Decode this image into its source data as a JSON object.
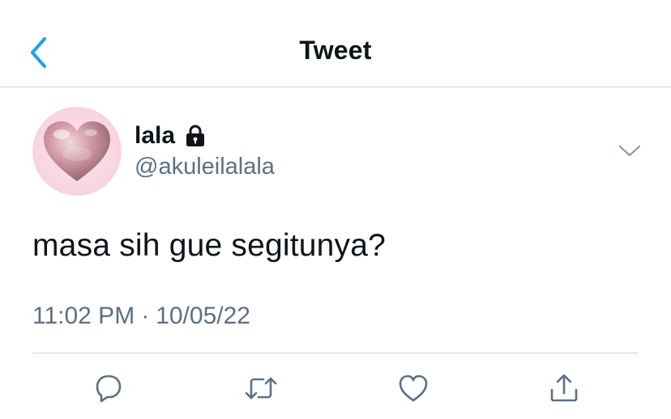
{
  "header": {
    "title": "Tweet",
    "back_icon": "chevron-left-icon"
  },
  "tweet": {
    "author_name": "lala",
    "author_handle": "@akuleilalala",
    "protected_icon": "lock-icon",
    "text": "masa sih gue segitunya?",
    "time": "11:02 PM",
    "separator": "·",
    "date": "10/05/22"
  },
  "actions": [
    "reply-icon",
    "retweet-icon",
    "like-icon",
    "share-icon"
  ],
  "colors": {
    "accent": "#1da1f2",
    "secondary_text": "#5b7083",
    "icon": "#5b7083",
    "divider": "#cfd5da"
  }
}
